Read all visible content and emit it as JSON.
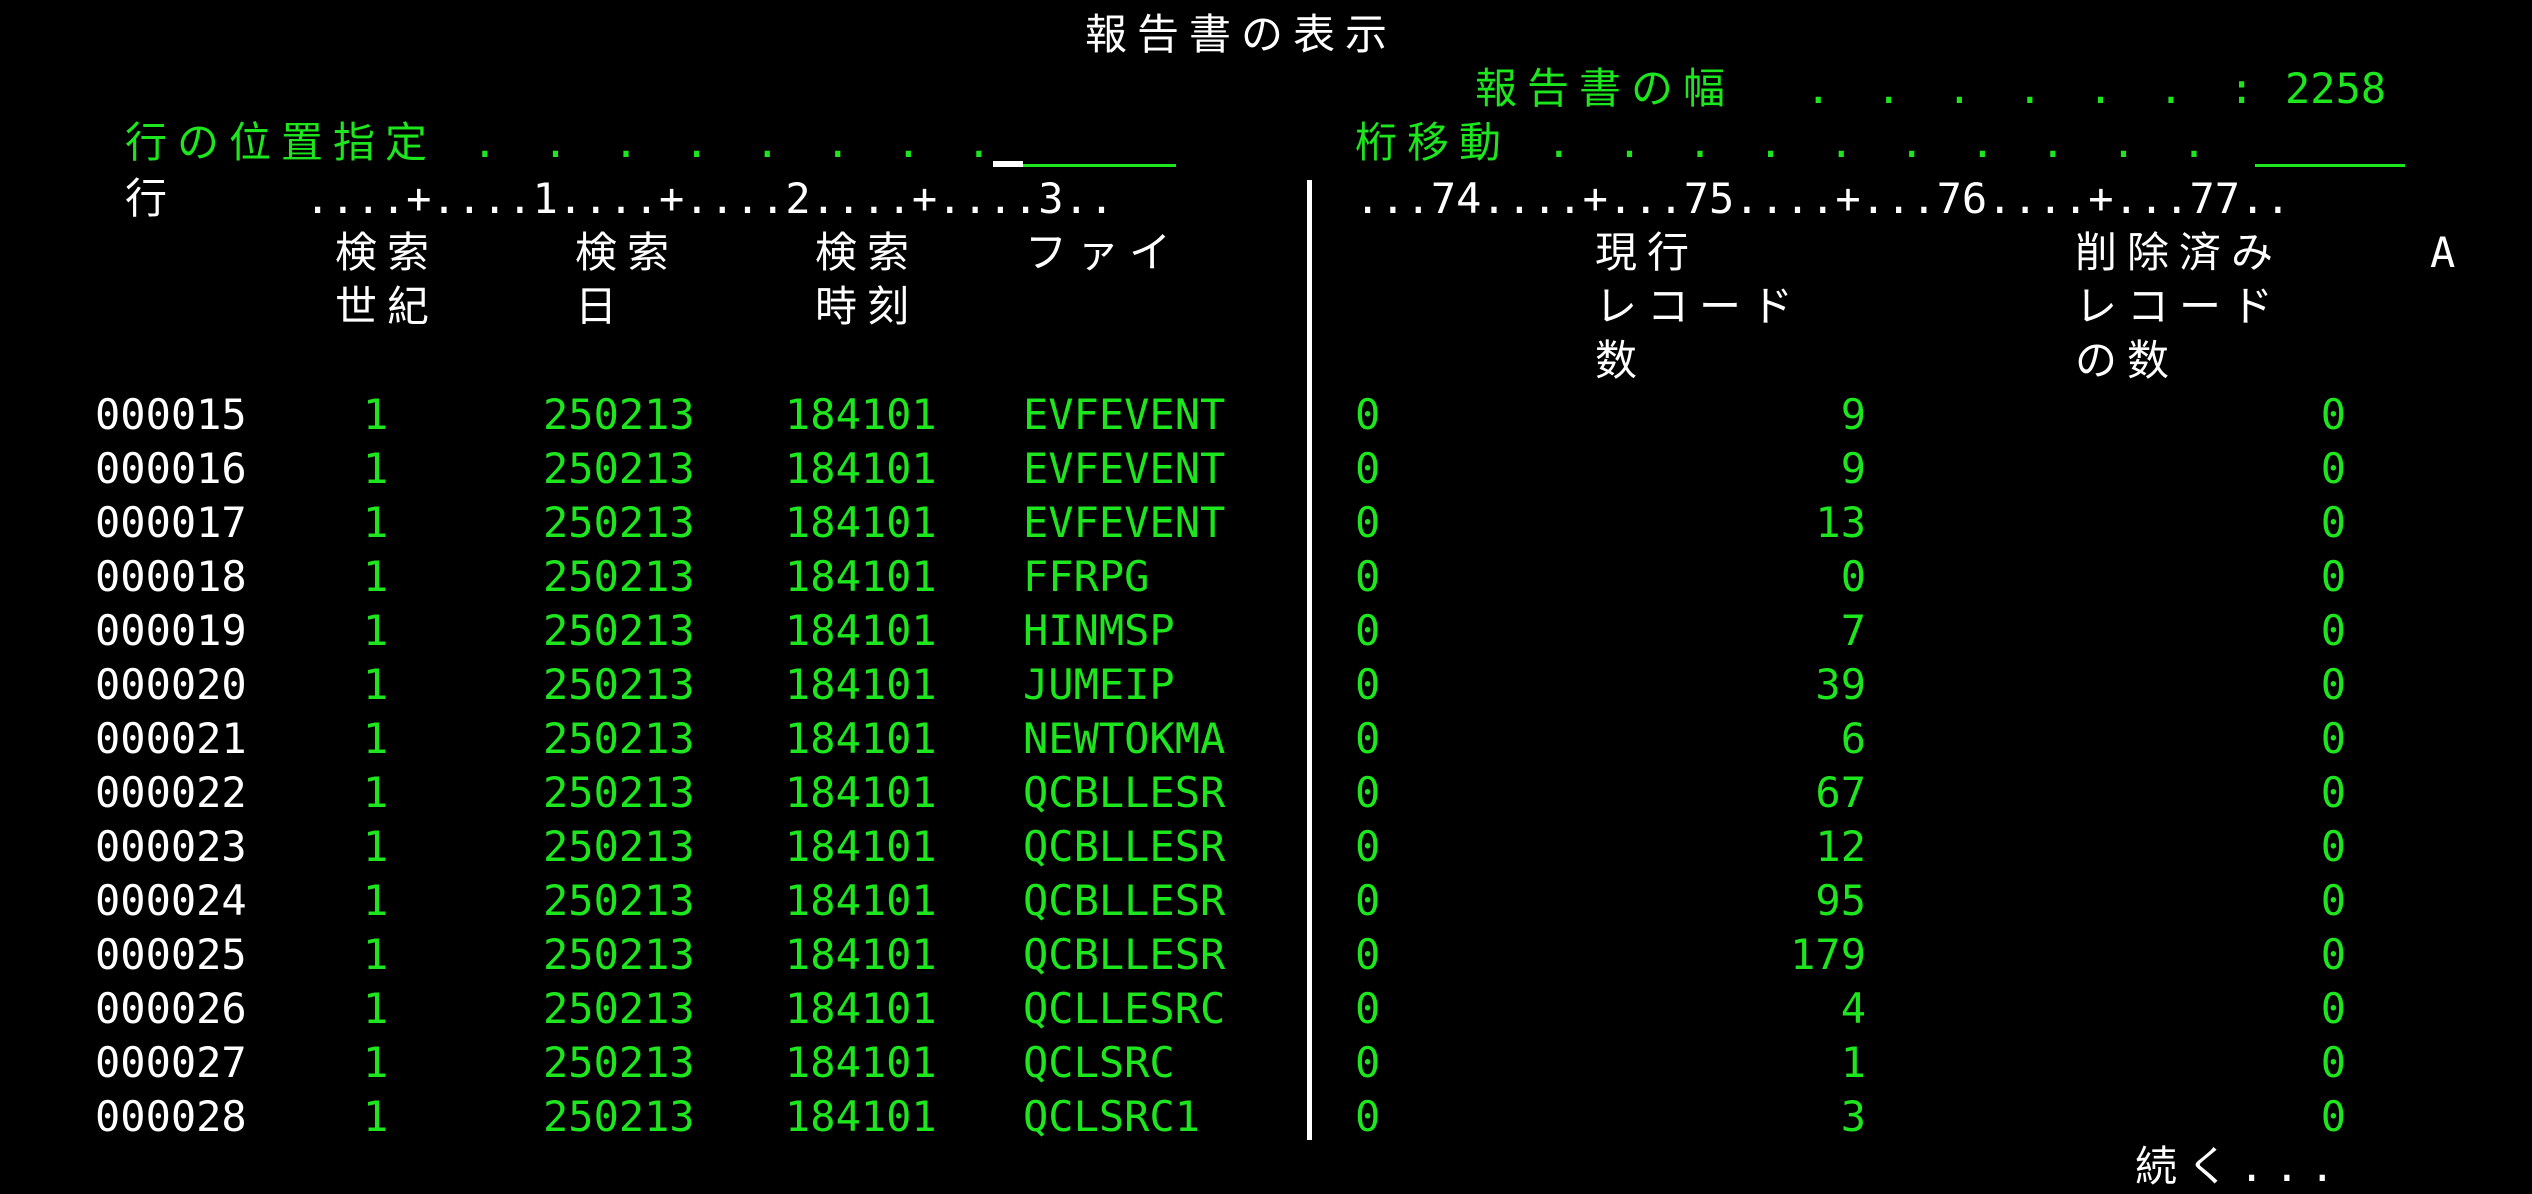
{
  "title": "報告書の表示",
  "report_width": {
    "label": "報告書の幅  . . . . . . :",
    "value": "2258"
  },
  "position_to_line": {
    "label": "行の位置指定 . . . . . . . .",
    "value": ""
  },
  "shift_columns": {
    "label": "桁移動 . . . . . . . . . .",
    "value": ""
  },
  "ruler": {
    "row_label": "行",
    "left": "....+....1....+....2....+....3..",
    "right": "...74....+...75....+...76....+...77.."
  },
  "headers": {
    "search_century": [
      "検索",
      "世紀"
    ],
    "search_date": [
      "検索",
      "日"
    ],
    "search_time": [
      "検索",
      "時刻"
    ],
    "file": [
      "ファイ"
    ],
    "current_records": [
      "現行",
      "レコード",
      "数"
    ],
    "deleted_records": [
      "削除済み",
      "レコード",
      "の数"
    ],
    "last_col": "A"
  },
  "rows": [
    {
      "line": "000015",
      "century": "1",
      "date": "250213",
      "time": "184101",
      "file": "EVFEVENT",
      "flag": "0",
      "current": "9",
      "deleted": "0"
    },
    {
      "line": "000016",
      "century": "1",
      "date": "250213",
      "time": "184101",
      "file": "EVFEVENT",
      "flag": "0",
      "current": "9",
      "deleted": "0"
    },
    {
      "line": "000017",
      "century": "1",
      "date": "250213",
      "time": "184101",
      "file": "EVFEVENT",
      "flag": "0",
      "current": "13",
      "deleted": "0"
    },
    {
      "line": "000018",
      "century": "1",
      "date": "250213",
      "time": "184101",
      "file": "FFRPG",
      "flag": "0",
      "current": "0",
      "deleted": "0"
    },
    {
      "line": "000019",
      "century": "1",
      "date": "250213",
      "time": "184101",
      "file": "HINMSP",
      "flag": "0",
      "current": "7",
      "deleted": "0"
    },
    {
      "line": "000020",
      "century": "1",
      "date": "250213",
      "time": "184101",
      "file": "JUMEIP",
      "flag": "0",
      "current": "39",
      "deleted": "0"
    },
    {
      "line": "000021",
      "century": "1",
      "date": "250213",
      "time": "184101",
      "file": "NEWTOKMA",
      "flag": "0",
      "current": "6",
      "deleted": "0"
    },
    {
      "line": "000022",
      "century": "1",
      "date": "250213",
      "time": "184101",
      "file": "QCBLLESR",
      "flag": "0",
      "current": "67",
      "deleted": "0"
    },
    {
      "line": "000023",
      "century": "1",
      "date": "250213",
      "time": "184101",
      "file": "QCBLLESR",
      "flag": "0",
      "current": "12",
      "deleted": "0"
    },
    {
      "line": "000024",
      "century": "1",
      "date": "250213",
      "time": "184101",
      "file": "QCBLLESR",
      "flag": "0",
      "current": "95",
      "deleted": "0"
    },
    {
      "line": "000025",
      "century": "1",
      "date": "250213",
      "time": "184101",
      "file": "QCBLLESR",
      "flag": "0",
      "current": "179",
      "deleted": "0"
    },
    {
      "line": "000026",
      "century": "1",
      "date": "250213",
      "time": "184101",
      "file": "QCLLESRC",
      "flag": "0",
      "current": "4",
      "deleted": "0"
    },
    {
      "line": "000027",
      "century": "1",
      "date": "250213",
      "time": "184101",
      "file": "QCLSRC",
      "flag": "0",
      "current": "1",
      "deleted": "0"
    },
    {
      "line": "000028",
      "century": "1",
      "date": "250213",
      "time": "184101",
      "file": "QCLSRC1",
      "flag": "0",
      "current": "3",
      "deleted": "0"
    }
  ],
  "more": "続く...",
  "colors": {
    "green": "#1ee61e",
    "white": "#ffffff",
    "background": "#000000"
  }
}
